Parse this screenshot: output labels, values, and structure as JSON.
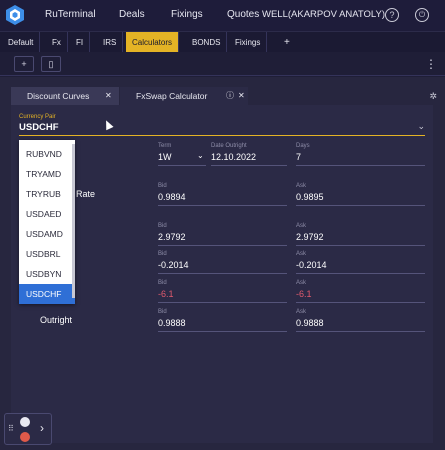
{
  "topbar": {
    "nav": [
      "RuTerminal",
      "Deals",
      "Fixings",
      "Quotes"
    ],
    "user": "WELL(AKARPOV ANATOLY)"
  },
  "tabs": [
    "Default",
    "Fx",
    "FI",
    "IRS",
    "Calculators",
    "BONDS",
    "Fixings",
    "+"
  ],
  "active_tab": "Calculators",
  "toolbar": {
    "add_label": "+",
    "doc_label": "▯",
    "menu_label": "⋮"
  },
  "subtabs": {
    "discount": "Discount Curves",
    "fxswap": "FxSwap Calculator"
  },
  "currency_pair": {
    "label": "Currency Pair",
    "value": "USDCHF"
  },
  "dropdown": {
    "options": [
      "RUBVND",
      "TRYAMD",
      "TRYRUB",
      "USDAED",
      "USDAMD",
      "USDBRL",
      "USDBYN",
      "USDCHF"
    ],
    "selected": "USDCHF"
  },
  "term": {
    "label": "Term",
    "value": "1W"
  },
  "date_outright": {
    "label": "Date Outright",
    "value": "12.10.2022"
  },
  "days": {
    "label": "Days",
    "value": "7"
  },
  "rate_row": {
    "label_fragment": "Rate",
    "bid_label": "Bid",
    "bid": "0.9894",
    "ask_label": "Ask",
    "ask": "0.9895"
  },
  "row2": {
    "bid_label": "Bid",
    "bid": "2.9792",
    "ask_label": "Ask",
    "ask": "2.9792"
  },
  "row3": {
    "bid_label": "Bid",
    "bid": "-0.2014",
    "ask_label": "Ask",
    "ask": "-0.2014"
  },
  "row4": {
    "bid_label": "Bid",
    "bid": "-6.1",
    "ask_label": "Ask",
    "ask": "-6.1"
  },
  "outright": {
    "label": "Outright",
    "bid_label": "Bid",
    "bid": "0.9888",
    "ask_label": "Ask",
    "ask": "0.9888"
  },
  "colors": {
    "accent": "#e4b325",
    "negative": "#e05a6e",
    "selection": "#2f6fd6"
  }
}
